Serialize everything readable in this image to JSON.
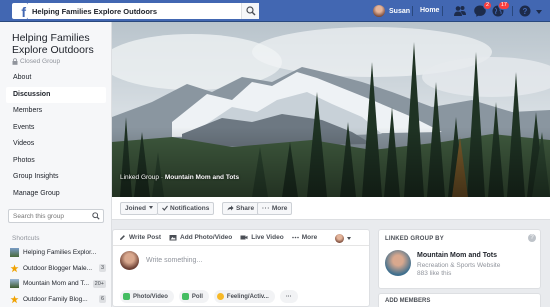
{
  "topbar": {
    "search_value": "Helping Families Explore Outdoors",
    "user_name": "Susan",
    "home_label": "Home",
    "friend_requests_badge": "",
    "messages_badge": "2",
    "notifications_badge": "17",
    "brand_color": "#4267b2"
  },
  "group": {
    "title": "Helping Families Explore Outdoors",
    "privacy": "Closed Group"
  },
  "nav": {
    "items": [
      {
        "label": "About"
      },
      {
        "label": "Discussion"
      },
      {
        "label": "Members"
      },
      {
        "label": "Events"
      },
      {
        "label": "Videos"
      },
      {
        "label": "Photos"
      },
      {
        "label": "Group Insights"
      },
      {
        "label": "Manage Group"
      }
    ],
    "active": "Discussion"
  },
  "left_search": {
    "placeholder": "Search this group"
  },
  "shortcuts": {
    "heading": "Shortcuts",
    "items": [
      {
        "label": "Helping Families Explor...",
        "count": ""
      },
      {
        "label": "Outdoor Blogger Male...",
        "count": "3"
      },
      {
        "label": "Mountain Mom and T...",
        "count": "20+"
      },
      {
        "label": "Outdoor Family Blog...",
        "count": "6"
      }
    ]
  },
  "cover": {
    "linked_prefix": "Linked Group ·",
    "linked_name": "Mountain Mom and Tots"
  },
  "actions": {
    "joined": "Joined",
    "notifications": "Notifications",
    "share": "Share",
    "more": "More"
  },
  "composer": {
    "tabs": {
      "write_post": "Write Post",
      "add_photo": "Add Photo/Video",
      "live_video": "Live Video",
      "more": "More"
    },
    "placeholder": "Write something...",
    "pills": {
      "photo_video": "Photo/Video",
      "poll": "Poll",
      "feeling": "Feeling/Activ..."
    }
  },
  "linked_card": {
    "heading": "LINKED GROUP BY",
    "page_name": "Mountain Mom and Tots",
    "category": "Recreation & Sports Website",
    "likes": "883 like this"
  },
  "add_members": {
    "heading": "ADD MEMBERS"
  }
}
